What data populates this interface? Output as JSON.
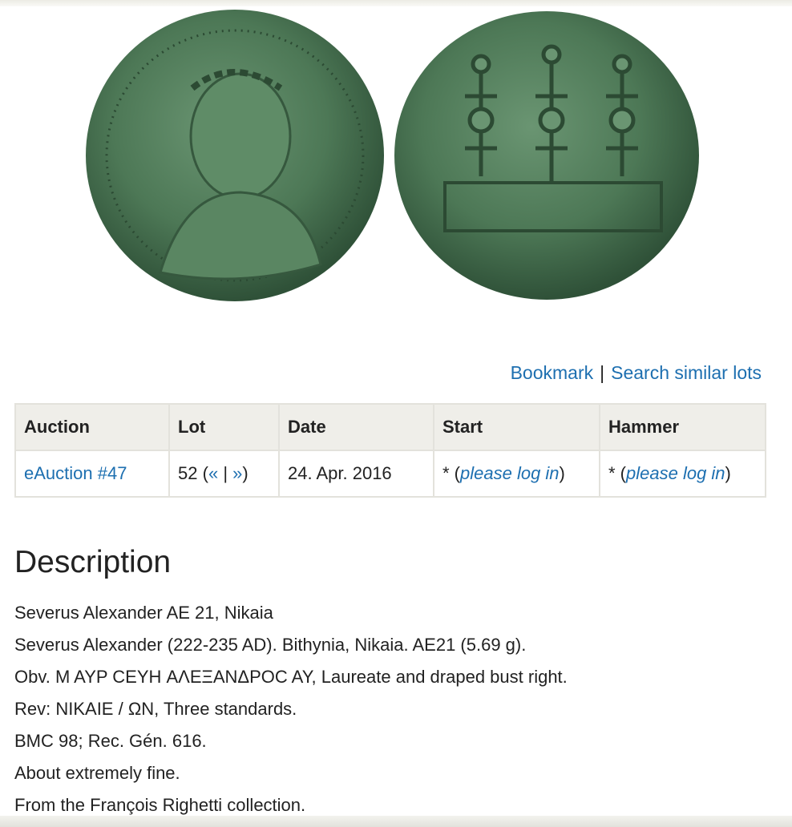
{
  "actions": {
    "bookmark": "Bookmark",
    "separator": "|",
    "search_similar": "Search similar lots"
  },
  "table": {
    "headers": [
      "Auction",
      "Lot",
      "Date",
      "Start",
      "Hammer"
    ],
    "row": {
      "auction": "eAuction #47",
      "lot_number": "52",
      "lot_open": "(",
      "prev": "«",
      "pipe": "|",
      "next": "»",
      "lot_close": ")",
      "date": "24. Apr. 2016",
      "start_prefix": "* (",
      "start_link": "please log in",
      "start_suffix": ")",
      "hammer_prefix": "* (",
      "hammer_link": "please log in",
      "hammer_suffix": ")"
    }
  },
  "description": {
    "title": "Description",
    "lines": [
      "Severus Alexander AE 21, Nikaia",
      "Severus Alexander (222-235 AD). Bithynia, Nikaia. AE21 (5.69 g).",
      "Obv. M AYP CEYH ΑΛΕΞΑΝΔΡΟC AY, Laureate and draped bust right.",
      "Rev: NIKAIE / ΩN, Three standards.",
      "BMC 98; Rec. Gén. 616.",
      "About extremely fine.",
      "From the François Righetti collection."
    ]
  },
  "colors": {
    "link": "#1d6fb0",
    "coin_patina": "#4f7a57",
    "table_header_bg": "#efeee9"
  }
}
